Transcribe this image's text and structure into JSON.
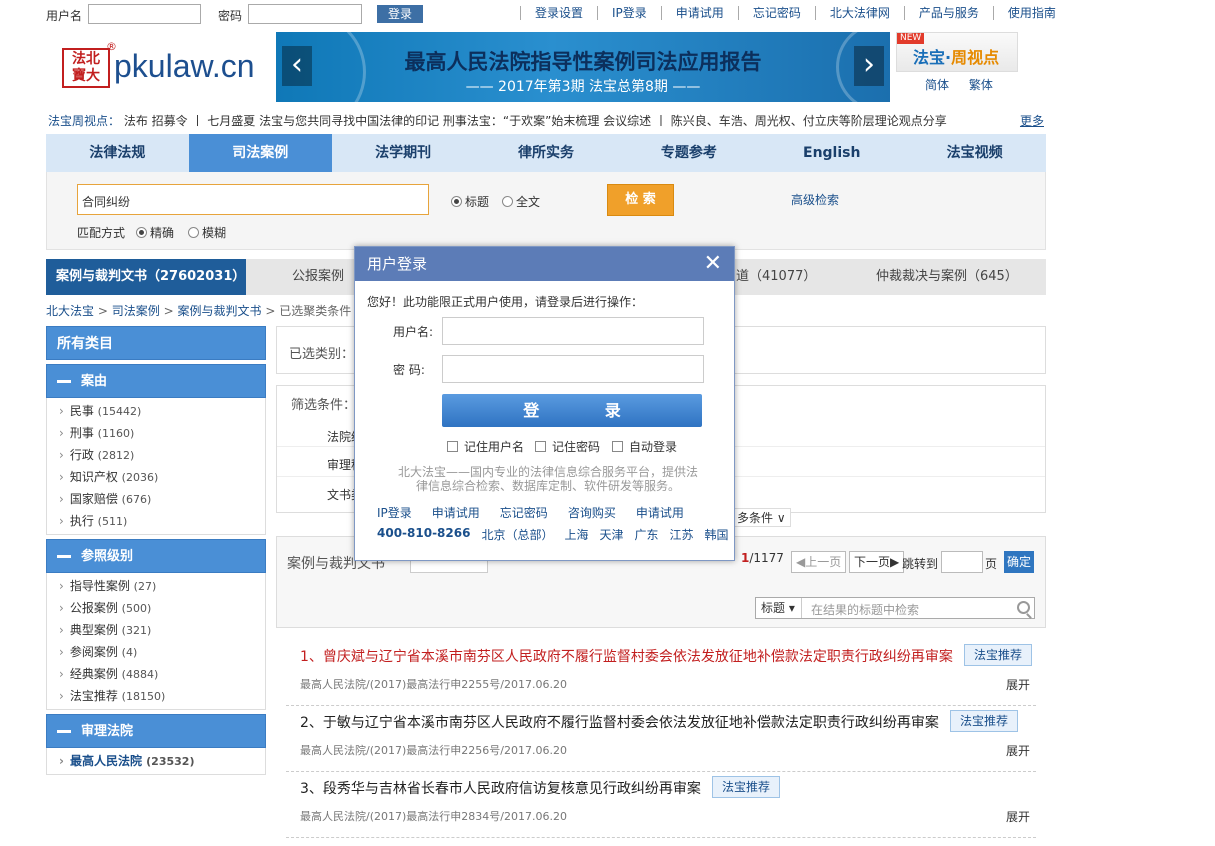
{
  "topbar": {
    "username_label": "用户名",
    "password_label": "密码",
    "login_button": "登录",
    "links": [
      "登录设置",
      "IP登录",
      "申请试用",
      "忘记密码",
      "北大法律网",
      "产品与服务",
      "使用指南"
    ]
  },
  "header": {
    "seal_text": "法北\n寶大",
    "domain": "pkulaw.cn",
    "banner_title": "最高人民法院指导性案例司法应用报告",
    "banner_subtitle": "—— 2017年第3期  法宝总第8期 ——",
    "zhou_new": "NEW",
    "zhou_title": "法宝·周视点",
    "lang_simplified": "简体",
    "lang_traditional": "繁体"
  },
  "ticker": {
    "label": "法宝周视点：",
    "text": "法布   招募令 丨 七月盛夏  法宝与您共同寻找中国法律的印记     刑事法宝：“于欢案”始末梳理       会议综述 丨 陈兴良、车浩、周光权、付立庆等阶层理论观点分享",
    "more": "更多"
  },
  "nav": {
    "items": [
      "法律法规",
      "司法案例",
      "法学期刊",
      "律所实务",
      "专题参考",
      "English",
      "法宝视频"
    ],
    "active_index": 1
  },
  "search": {
    "query": "合同纠纷",
    "scope_title": "标题",
    "scope_full": "全文",
    "button": "检 索",
    "advanced": "高级检索",
    "match_label": "匹配方式",
    "match_exact": "精确",
    "match_fuzzy": "模糊"
  },
  "category_tabs": {
    "active": "案例与裁判文书（27602031）",
    "tab2": "公报案例",
    "tab3": "道（41077）",
    "tab4": "仲裁裁决与案例（645）"
  },
  "breadcrumb": [
    "北大法宝",
    "司法案例",
    "案例与裁判文书",
    "已选聚类条件"
  ],
  "sidebar": {
    "title": "所有类目",
    "sections": [
      {
        "name": "案由",
        "items": [
          [
            "民事",
            "(15442)"
          ],
          [
            "刑事",
            "(1160)"
          ],
          [
            "行政",
            "(2812)"
          ],
          [
            "知识产权",
            "(2036)"
          ],
          [
            "国家赔偿",
            "(676)"
          ],
          [
            "执行",
            "(511)"
          ]
        ]
      },
      {
        "name": "参照级别",
        "items": [
          [
            "指导性案例",
            "(27)"
          ],
          [
            "公报案例",
            "(500)"
          ],
          [
            "典型案例",
            "(321)"
          ],
          [
            "参阅案例",
            "(4)"
          ],
          [
            "经典案例",
            "(4884)"
          ],
          [
            "法宝推荐",
            "(18150)"
          ]
        ]
      },
      {
        "name": "审理法院",
        "items": [
          [
            "最高人民法院",
            "(23532)"
          ]
        ]
      }
    ]
  },
  "selected_box": {
    "label": "已选类别："
  },
  "filter_box": {
    "title": "筛选条件：",
    "rows": [
      "法院级",
      "审理程",
      "文书类"
    ],
    "more": "多条件 ∨"
  },
  "list_header": {
    "title": "案例与裁判文书",
    "page_current": "1",
    "page_total": "/1177",
    "prev": "◀上一页",
    "next": "下一页▶",
    "jump_label": "跳转到",
    "page_unit": "页",
    "confirm": "确定",
    "result_scope": "标题 ▾",
    "result_placeholder": "在结果的标题中检索"
  },
  "results": [
    {
      "title": "1、曾庆斌与辽宁省本溪市南芬区人民政府不履行监督村委会依法发放征地补偿款法定职责行政纠纷再审案",
      "tag": "法宝推荐",
      "meta": "最高人民法院/(2017)最高法行申2255号/2017.06.20",
      "expand": "展开"
    },
    {
      "title": "2、于敏与辽宁省本溪市南芬区人民政府不履行监督村委会依法发放征地补偿款法定职责行政纠纷再审案",
      "tag": "法宝推荐",
      "meta": "最高人民法院/(2017)最高法行申2256号/2017.06.20",
      "expand": "展开"
    },
    {
      "title": "3、段秀华与吉林省长春市人民政府信访复核意见行政纠纷再审案",
      "tag": "法宝推荐",
      "meta": "最高人民法院/(2017)最高法行申2834号/2017.06.20",
      "expand": "展开"
    }
  ],
  "modal": {
    "title": "用户登录",
    "close": "✕",
    "hello": "您好！此功能限正式用户使用，请登录后进行操作：",
    "username_label": "用户名:",
    "password_label": "密  码:",
    "login_button": "登 录",
    "remember_user": "记住用户名",
    "remember_password": "记住密码",
    "auto_login": "自动登录",
    "intro": "北大法宝——国内专业的法律信息综合服务平台，提供法律信息综合检索、数据库定制、软件研发等服务。",
    "links": [
      "IP登录",
      "申请试用",
      "忘记密码",
      "咨询购买",
      "申请试用"
    ],
    "phone": "400-810-8266",
    "offices": [
      "北京（总部）",
      "上海",
      "天津",
      "广东",
      "江苏",
      "韩国"
    ]
  }
}
